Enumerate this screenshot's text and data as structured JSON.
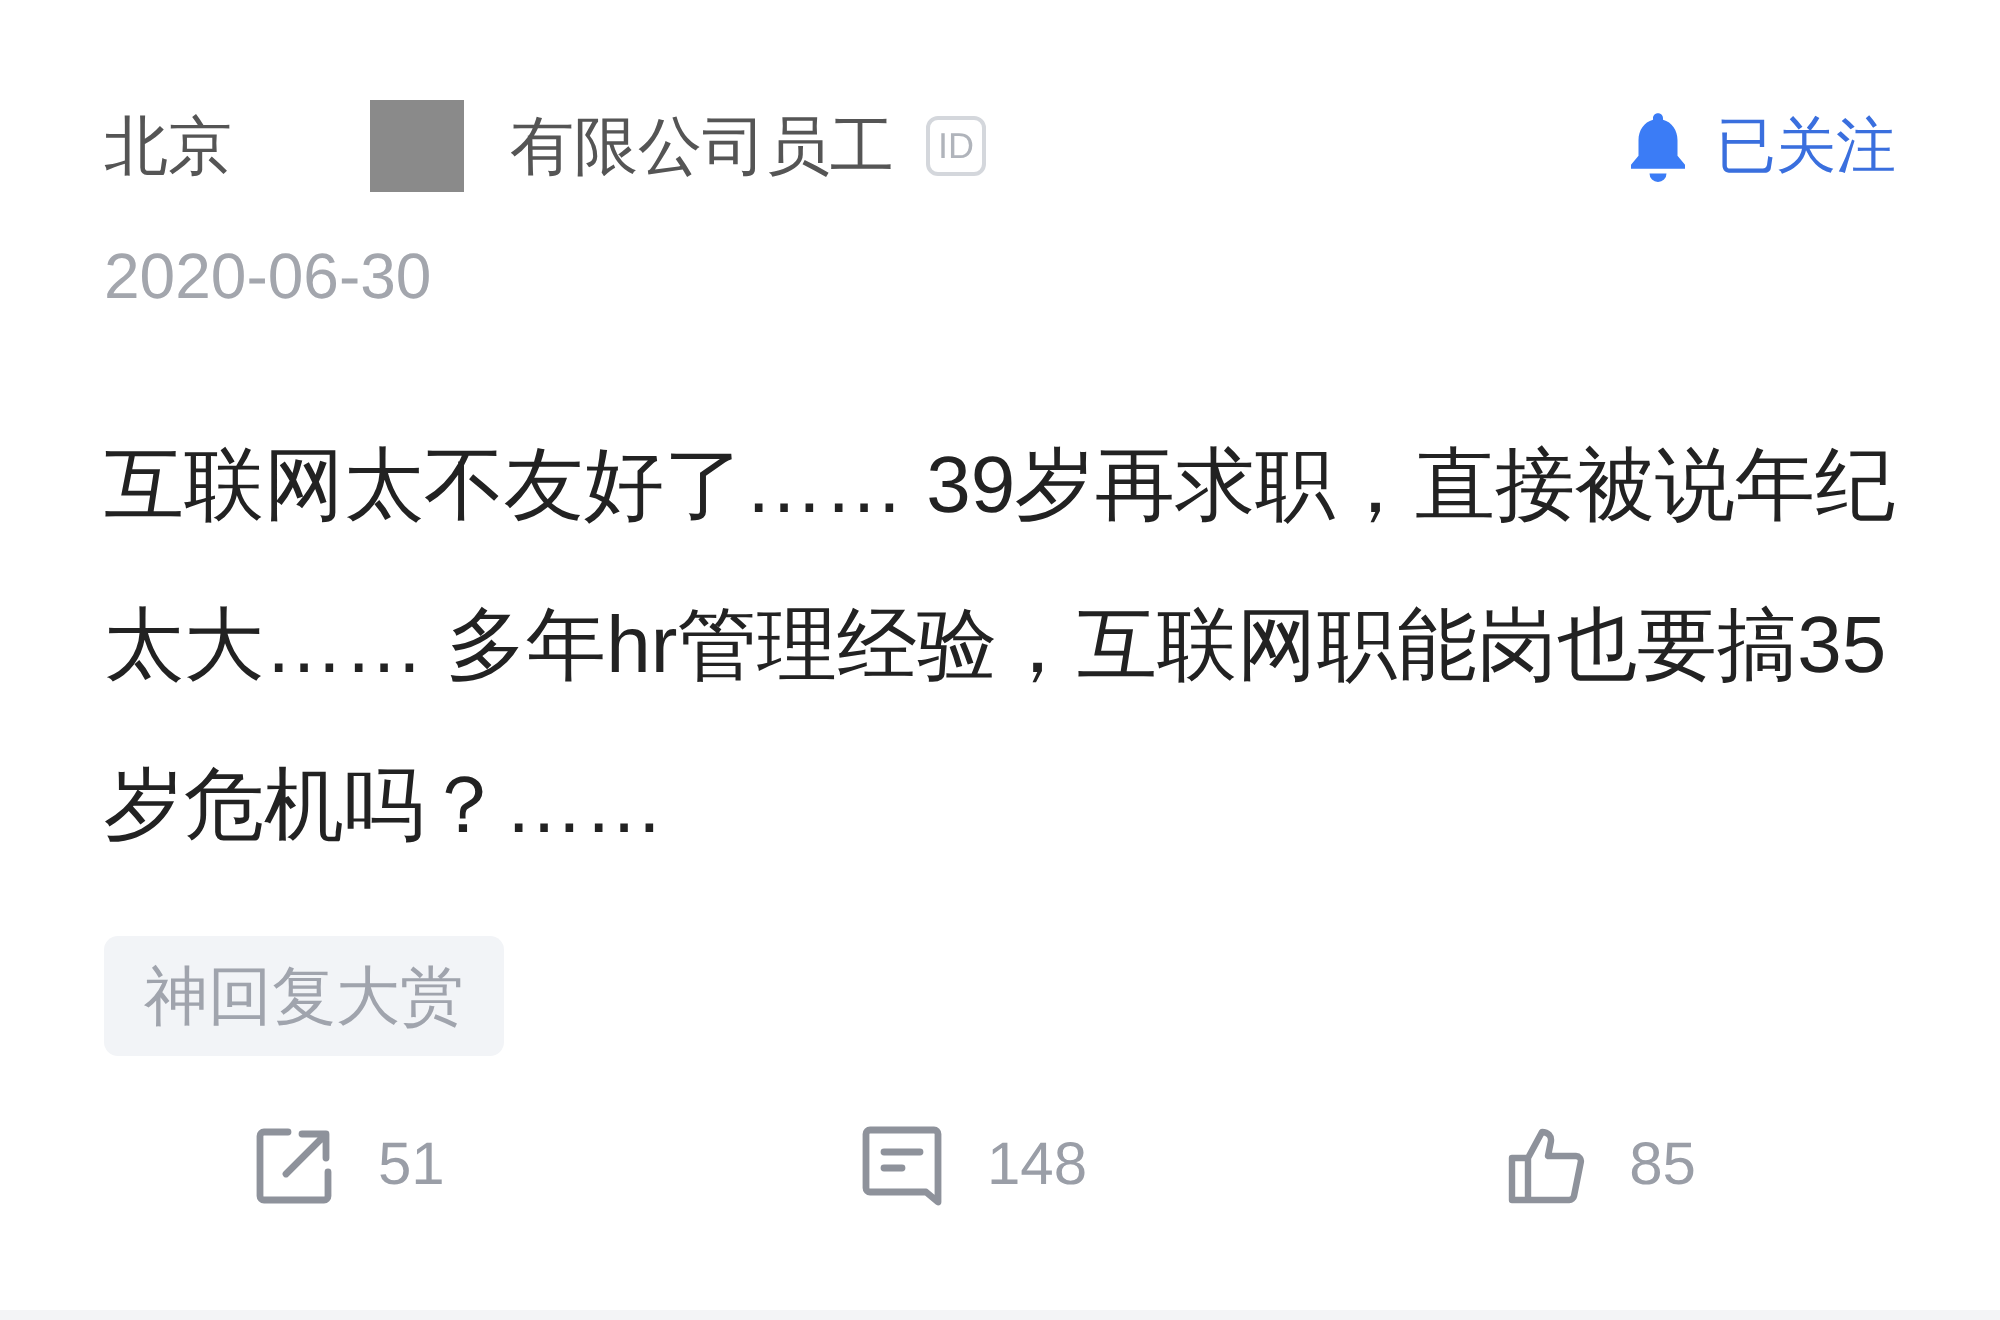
{
  "author": {
    "name_parts": [
      "北京",
      "有限公司员工"
    ],
    "badge": "ID",
    "date": "2020-06-30"
  },
  "follow": {
    "label": "已关注"
  },
  "post": {
    "text": "互联网太不友好了…… 39岁再求职，直接被说年纪太大…… 多年hr管理经验，互联网职能岗也要搞35岁危机吗？……"
  },
  "tags": [
    "神回复大赏"
  ],
  "actions": [
    {
      "kind": "share",
      "count": "51"
    },
    {
      "kind": "comment",
      "count": "148"
    },
    {
      "kind": "like",
      "count": "85"
    }
  ]
}
